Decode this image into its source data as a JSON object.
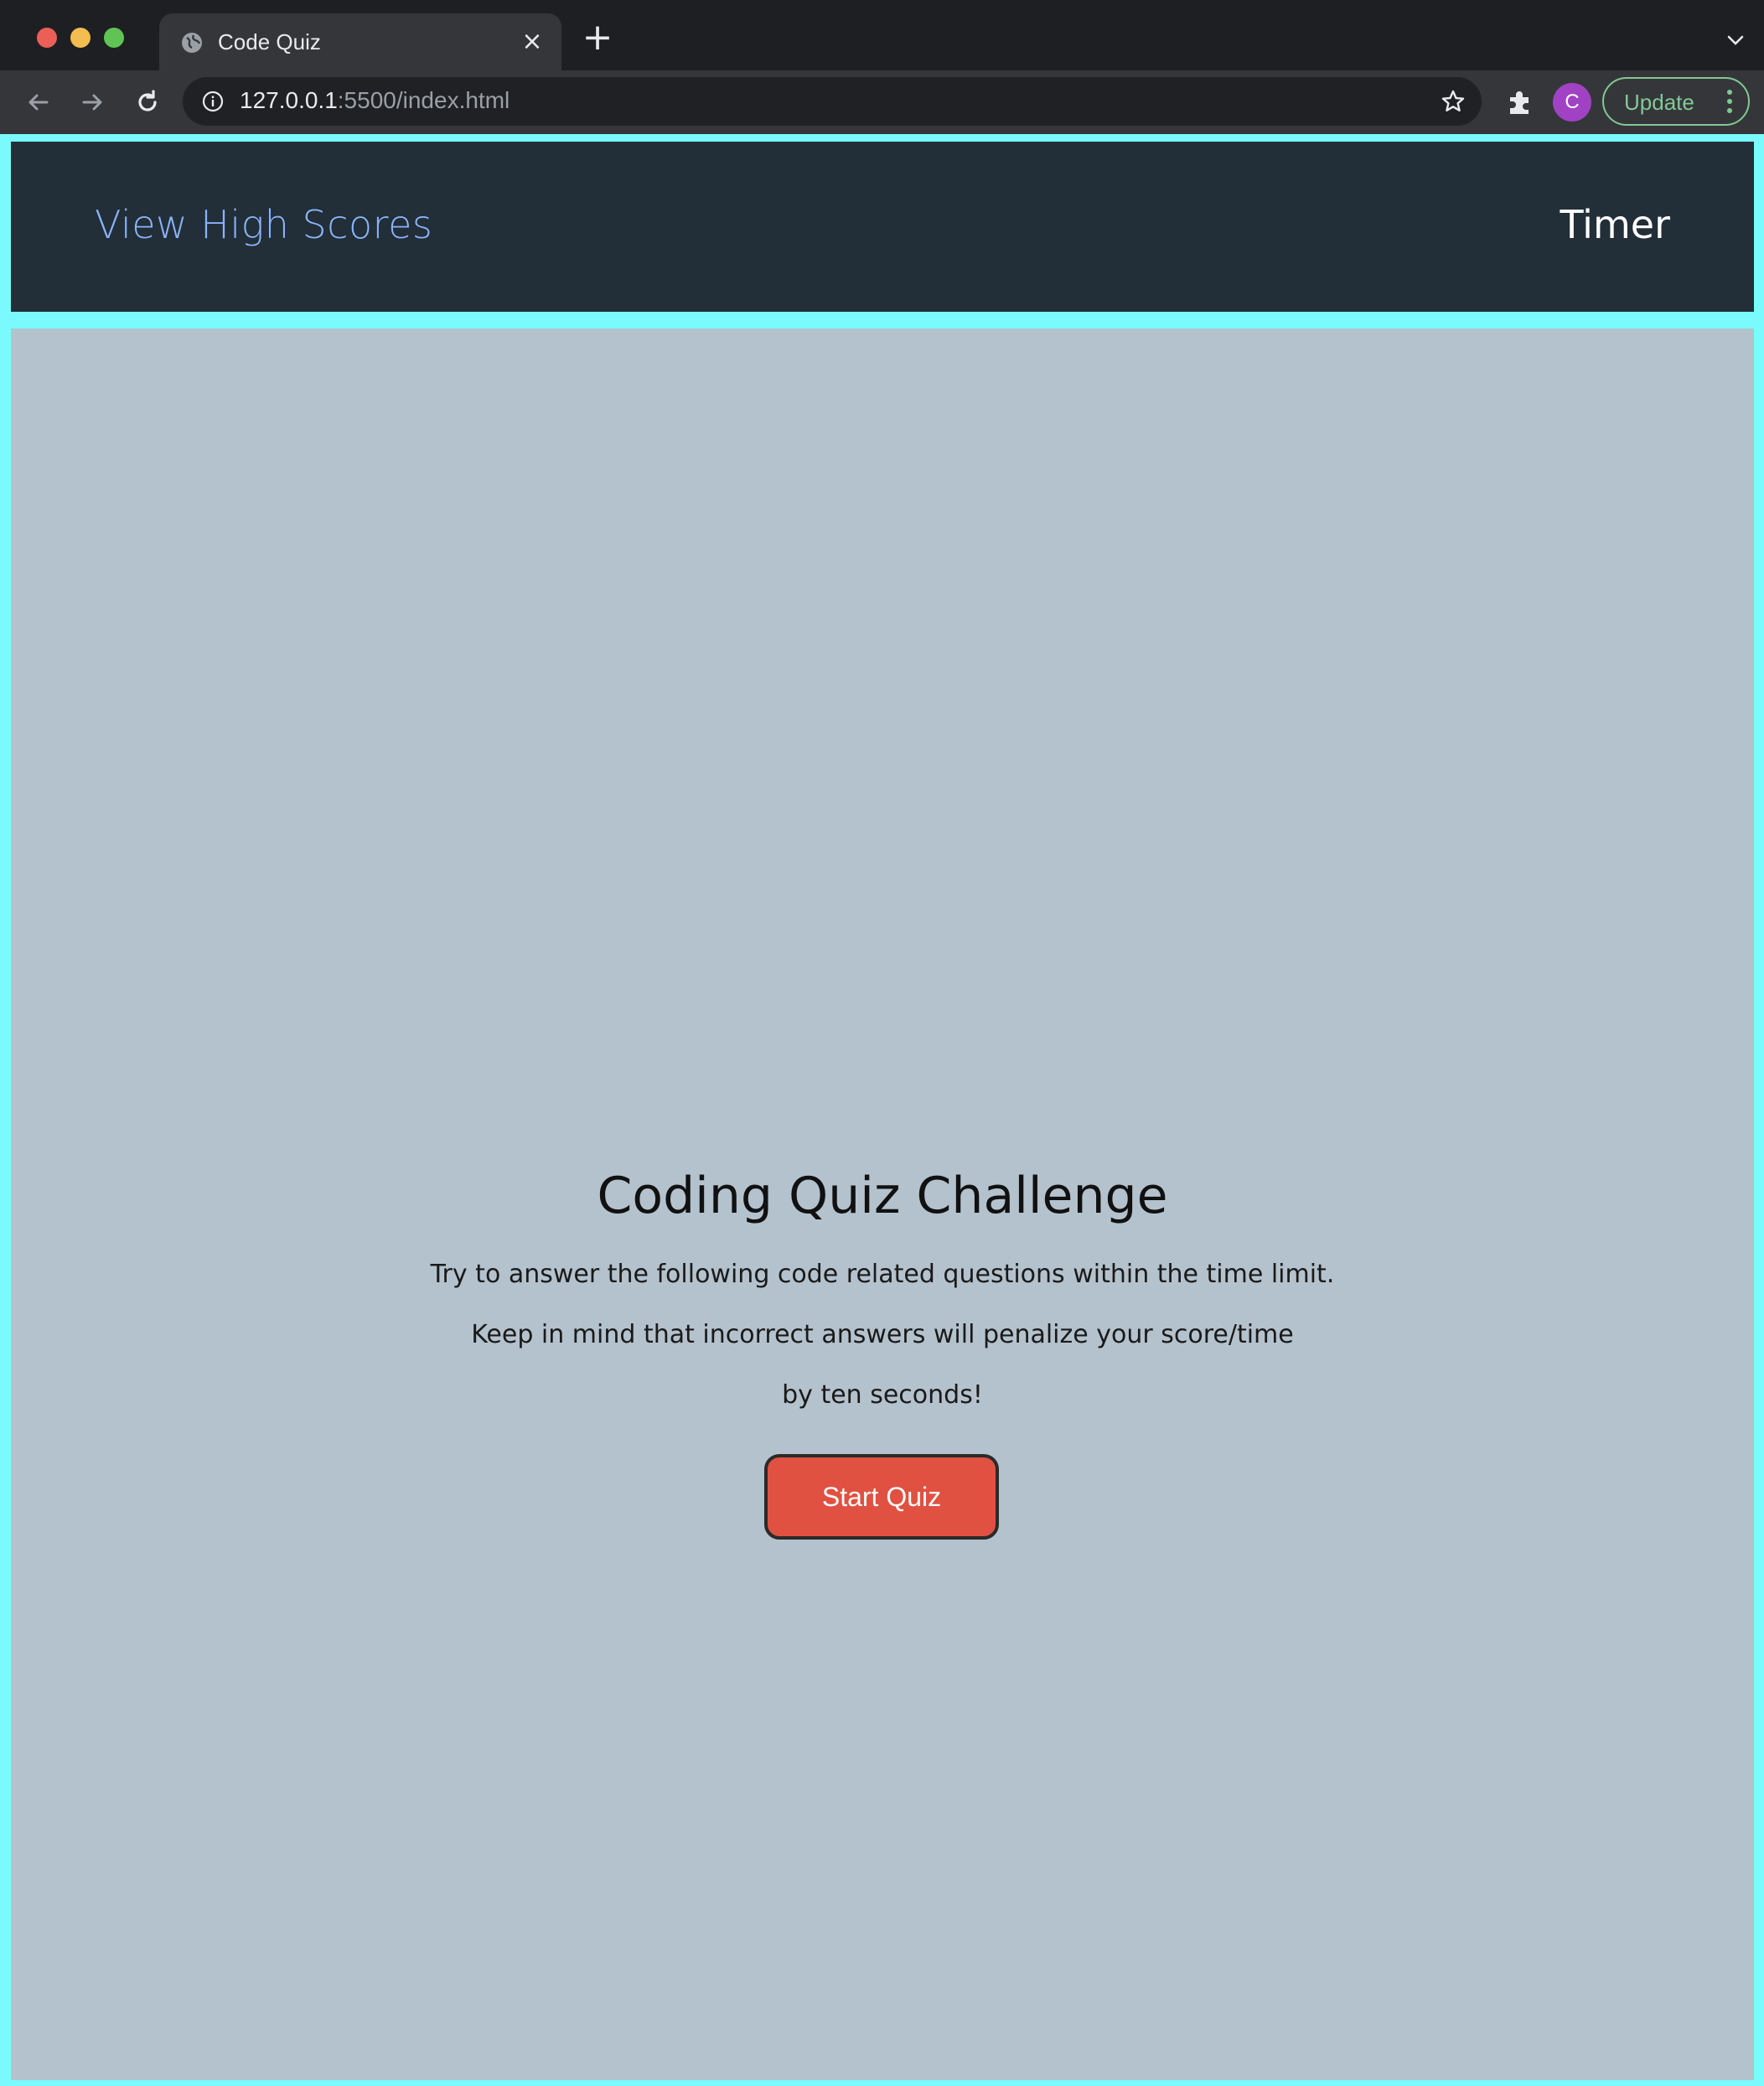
{
  "browser": {
    "tab": {
      "title": "Code Quiz",
      "close_glyph": "×"
    },
    "new_tab_glyph": "+",
    "address": {
      "host": "127.0.0.1",
      "rest": ":5500/index.html"
    },
    "profile_initial": "C",
    "update_label": "Update",
    "colors": {
      "tabbar": "#1e1f22",
      "toolbar": "#35363a",
      "update_accent": "#81c995",
      "avatar": "#a142c4"
    },
    "icons": [
      "globe-icon",
      "close-icon",
      "plus-icon",
      "chevron-down-icon",
      "back-arrow-icon",
      "forward-arrow-icon",
      "reload-icon",
      "info-icon",
      "star-icon",
      "puzzle-icon",
      "kebab-menu-icon"
    ]
  },
  "page": {
    "header": {
      "high_scores_link": "View High Scores",
      "timer_label": "Timer"
    },
    "quiz": {
      "title": "Coding Quiz Challenge",
      "lines": [
        "Try to answer the following code related questions within the time limit.",
        "Keep in mind that incorrect answers will penalize your score/time",
        "by ten seconds!"
      ],
      "start_button": "Start Quiz"
    },
    "colors": {
      "border": "#7afafc",
      "header_bg": "#222e38",
      "link": "#8ab4f8",
      "main_bg": "#b4c2cd",
      "button_bg": "#e05141"
    }
  }
}
